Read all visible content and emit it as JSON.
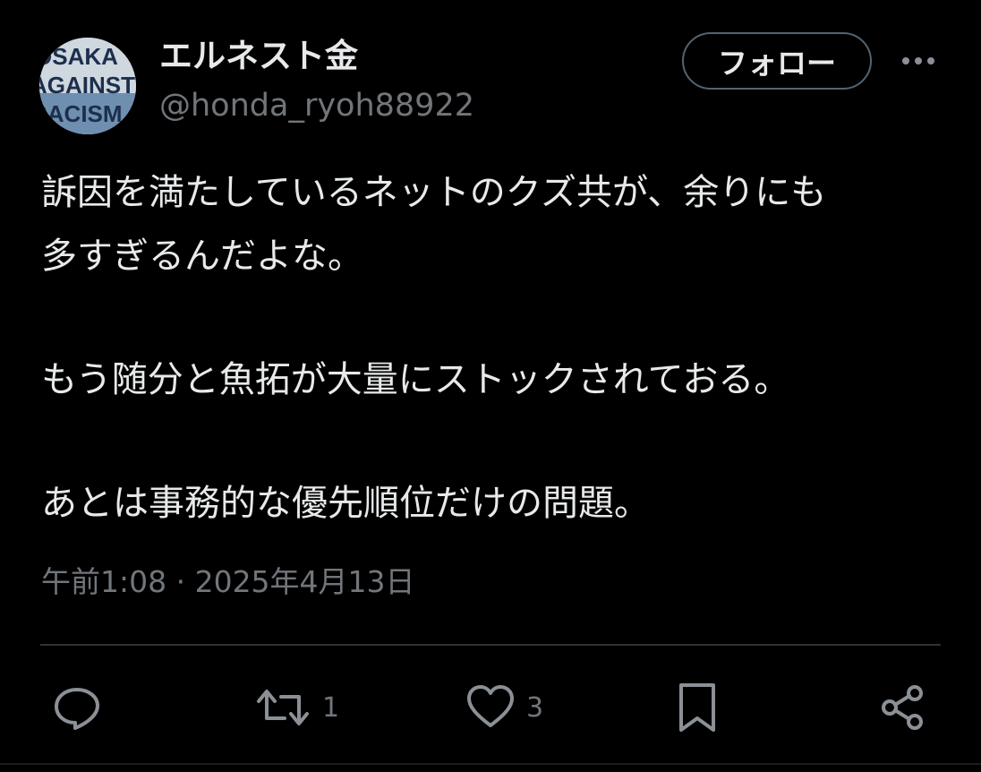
{
  "author": {
    "display_name": "エルネスト金",
    "handle": "@honda_ryoh88922",
    "avatar_text": [
      "OSAKA",
      "AGAINST",
      "RACISM"
    ]
  },
  "follow_label": "フォロー",
  "more_icon": "more-horizontal-icon",
  "post": {
    "lines": [
      "訴因を満たしているネットのクズ共が、余りにも",
      "多すぎるんだよな。",
      "もう随分と魚拓が大量にストックされておる。",
      "あとは事務的な優先順位だけの問題。"
    ],
    "timestamp": "午前1:08 · 2025年4月13日"
  },
  "actions": {
    "reply": {
      "icon": "reply-icon"
    },
    "repost": {
      "icon": "repost-icon",
      "count": "1"
    },
    "like": {
      "icon": "like-icon",
      "count": "3"
    },
    "bookmark": {
      "icon": "bookmark-icon"
    },
    "share": {
      "icon": "share-icon"
    }
  },
  "colors": {
    "background": "#000000",
    "text_primary": "#e7e9ea",
    "text_secondary": "#71767b",
    "border": "#536471",
    "divider": "#2f3336"
  }
}
